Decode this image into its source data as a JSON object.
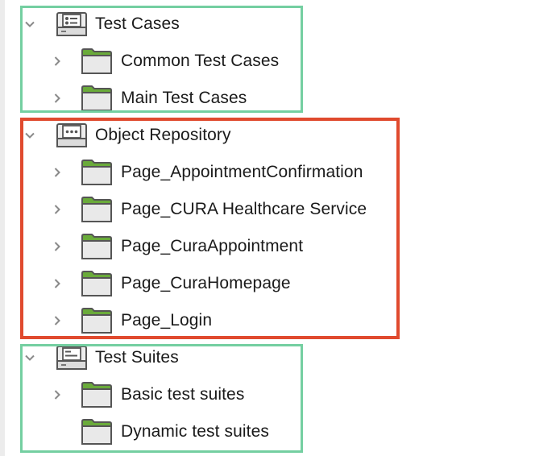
{
  "colors": {
    "group_highlight": "#74cfa1",
    "selected_highlight": "#e04a2e",
    "folder_tab": "#6aab3a",
    "folder_outline": "#555555",
    "chevron": "#8a8a8a"
  },
  "tree": {
    "test_cases": {
      "label": "Test Cases",
      "icon": "test-cases-root-icon",
      "expanded": true,
      "children": [
        {
          "label": "Common Test Cases",
          "icon": "folder-icon"
        },
        {
          "label": "Main Test Cases",
          "icon": "folder-icon"
        }
      ]
    },
    "object_repository": {
      "label": "Object Repository",
      "icon": "object-repository-root-icon",
      "expanded": true,
      "children": [
        {
          "label": "Page_AppointmentConfirmation",
          "icon": "folder-icon"
        },
        {
          "label": "Page_CURA Healthcare Service",
          "icon": "folder-icon"
        },
        {
          "label": "Page_CuraAppointment",
          "icon": "folder-icon"
        },
        {
          "label": "Page_CuraHomepage",
          "icon": "folder-icon"
        },
        {
          "label": "Page_Login",
          "icon": "folder-icon"
        }
      ]
    },
    "test_suites": {
      "label": "Test Suites",
      "icon": "test-suites-root-icon",
      "expanded": true,
      "children": [
        {
          "label": "Basic test suites",
          "icon": "folder-icon",
          "has_children": true
        },
        {
          "label": "Dynamic test suites",
          "icon": "folder-icon",
          "has_children": false
        }
      ]
    }
  }
}
